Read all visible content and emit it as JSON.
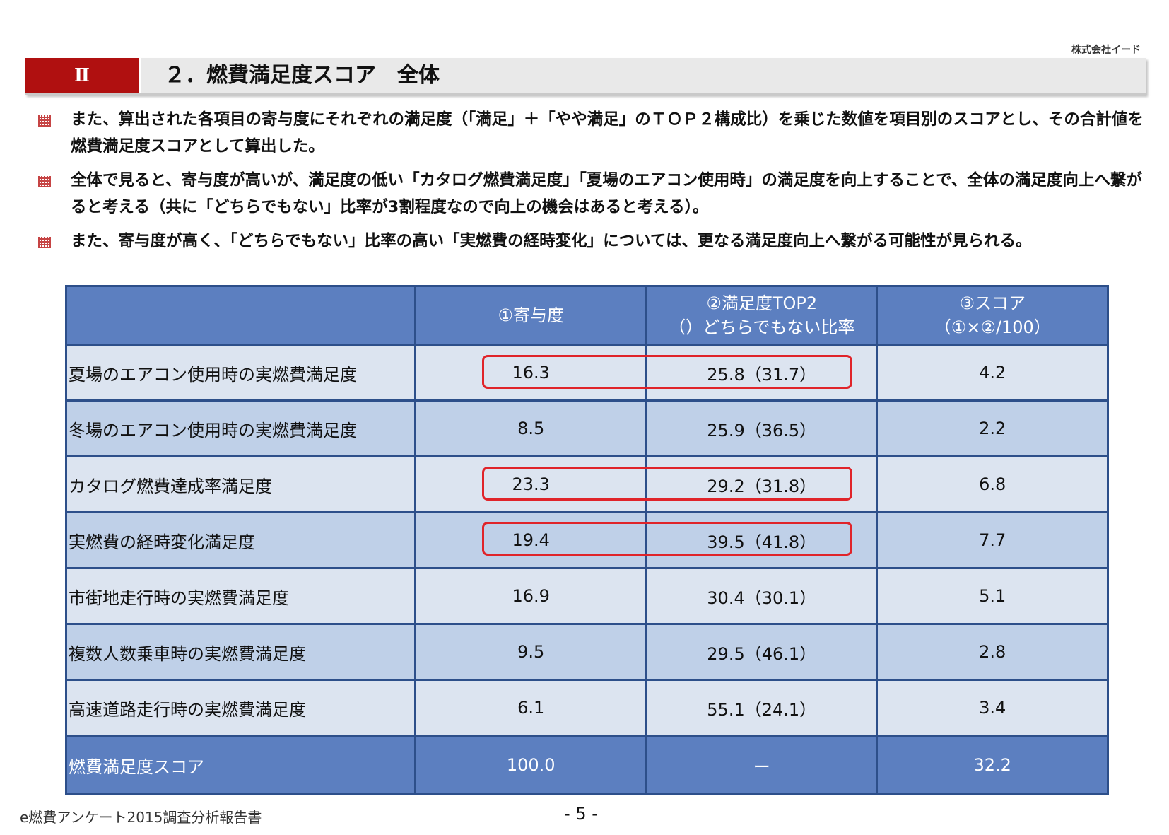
{
  "company": "株式会社イード",
  "header": {
    "section": "Ⅱ",
    "title": "２．燃費満足度スコア　全体"
  },
  "bullets": [
    "また、算出された各項目の寄与度にそれぞれの満足度（「満足」＋「やや満足」のＴＯＰ２構成比）を乗じた数値を項目別のスコアとし、その合計値を燃費満足度スコアとして算出した。",
    "全体で見ると、寄与度が高いが、満足度の低い「カタログ燃費満足度」「夏場のエアコン使用時」の満足度を向上することで、全体の満足度向上へ繋がると考える（共に「どちらでもない」比率が3割程度なので向上の機会はあると考える）。",
    "また、寄与度が高く、「どちらでもない」比率の高い「実燃費の経時変化」については、更なる満足度向上へ繋がる可能性が見られる。"
  ],
  "table": {
    "headers": {
      "col0": "",
      "col1": "①寄与度",
      "col2_line1": "②満足度TOP2",
      "col2_line2": "（）どちらでもない比率",
      "col3_line1": "③スコア",
      "col3_line2": "（①×②/100）"
    },
    "rows": [
      {
        "label": "夏場のエアコン使用時の実燃費満足度",
        "contribution": "16.3",
        "top2": "25.8（31.7）",
        "score": "4.2"
      },
      {
        "label": "冬場のエアコン使用時の実燃費満足度",
        "contribution": "8.5",
        "top2": "25.9（36.5）",
        "score": "2.2"
      },
      {
        "label": "カタログ燃費達成率満足度",
        "contribution": "23.3",
        "top2": "29.2（31.8）",
        "score": "6.8"
      },
      {
        "label": "実燃費の経時変化満足度",
        "contribution": "19.4",
        "top2": "39.5（41.8）",
        "score": "7.7"
      },
      {
        "label": "市街地走行時の実燃費満足度",
        "contribution": "16.9",
        "top2": "30.4（30.1）",
        "score": "5.1"
      },
      {
        "label": "複数人数乗車時の実燃費満足度",
        "contribution": "9.5",
        "top2": "29.5（46.1）",
        "score": "2.8"
      },
      {
        "label": "高速道路走行時の実燃費満足度",
        "contribution": "6.1",
        "top2": "55.1（24.1）",
        "score": "3.4"
      }
    ],
    "total": {
      "label": "燃費満足度スコア",
      "contribution": "100.0",
      "top2": "ー",
      "score": "32.2"
    }
  },
  "footer": {
    "report_name": "e燃費アンケート2015調査分析報告書",
    "page": "- 5 -"
  },
  "colors": {
    "accent_red": "#b01010",
    "header_blue": "#5c7fc0",
    "row_light": "#dce4f0",
    "row_dark": "#bfd0e8",
    "highlight": "#e0242a"
  }
}
